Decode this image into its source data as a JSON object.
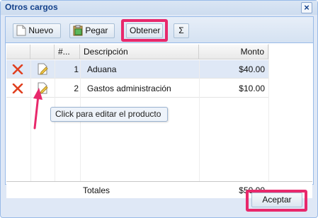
{
  "window": {
    "title": "Otros cargos",
    "close_symbol": "×"
  },
  "toolbar": {
    "new_label": "Nuevo",
    "paste_label": "Pegar",
    "fetch_label": "Obtener",
    "sum_symbol": "Σ"
  },
  "table": {
    "columns": [
      "#...",
      "Descripción",
      "Monto"
    ],
    "rows": [
      {
        "num": "1",
        "description": "Aduana",
        "amount": "$40.00"
      },
      {
        "num": "2",
        "description": "Gastos administración",
        "amount": "$10.00"
      }
    ],
    "footer": {
      "label": "Totales",
      "total": "$50.00"
    }
  },
  "tooltip": {
    "text": "Click para editar el producto"
  },
  "buttons": {
    "accept_label": "Aceptar"
  },
  "colors": {
    "highlight": "#e8286b",
    "window_bg": "#dfe8f6",
    "title_color": "#15428b"
  }
}
